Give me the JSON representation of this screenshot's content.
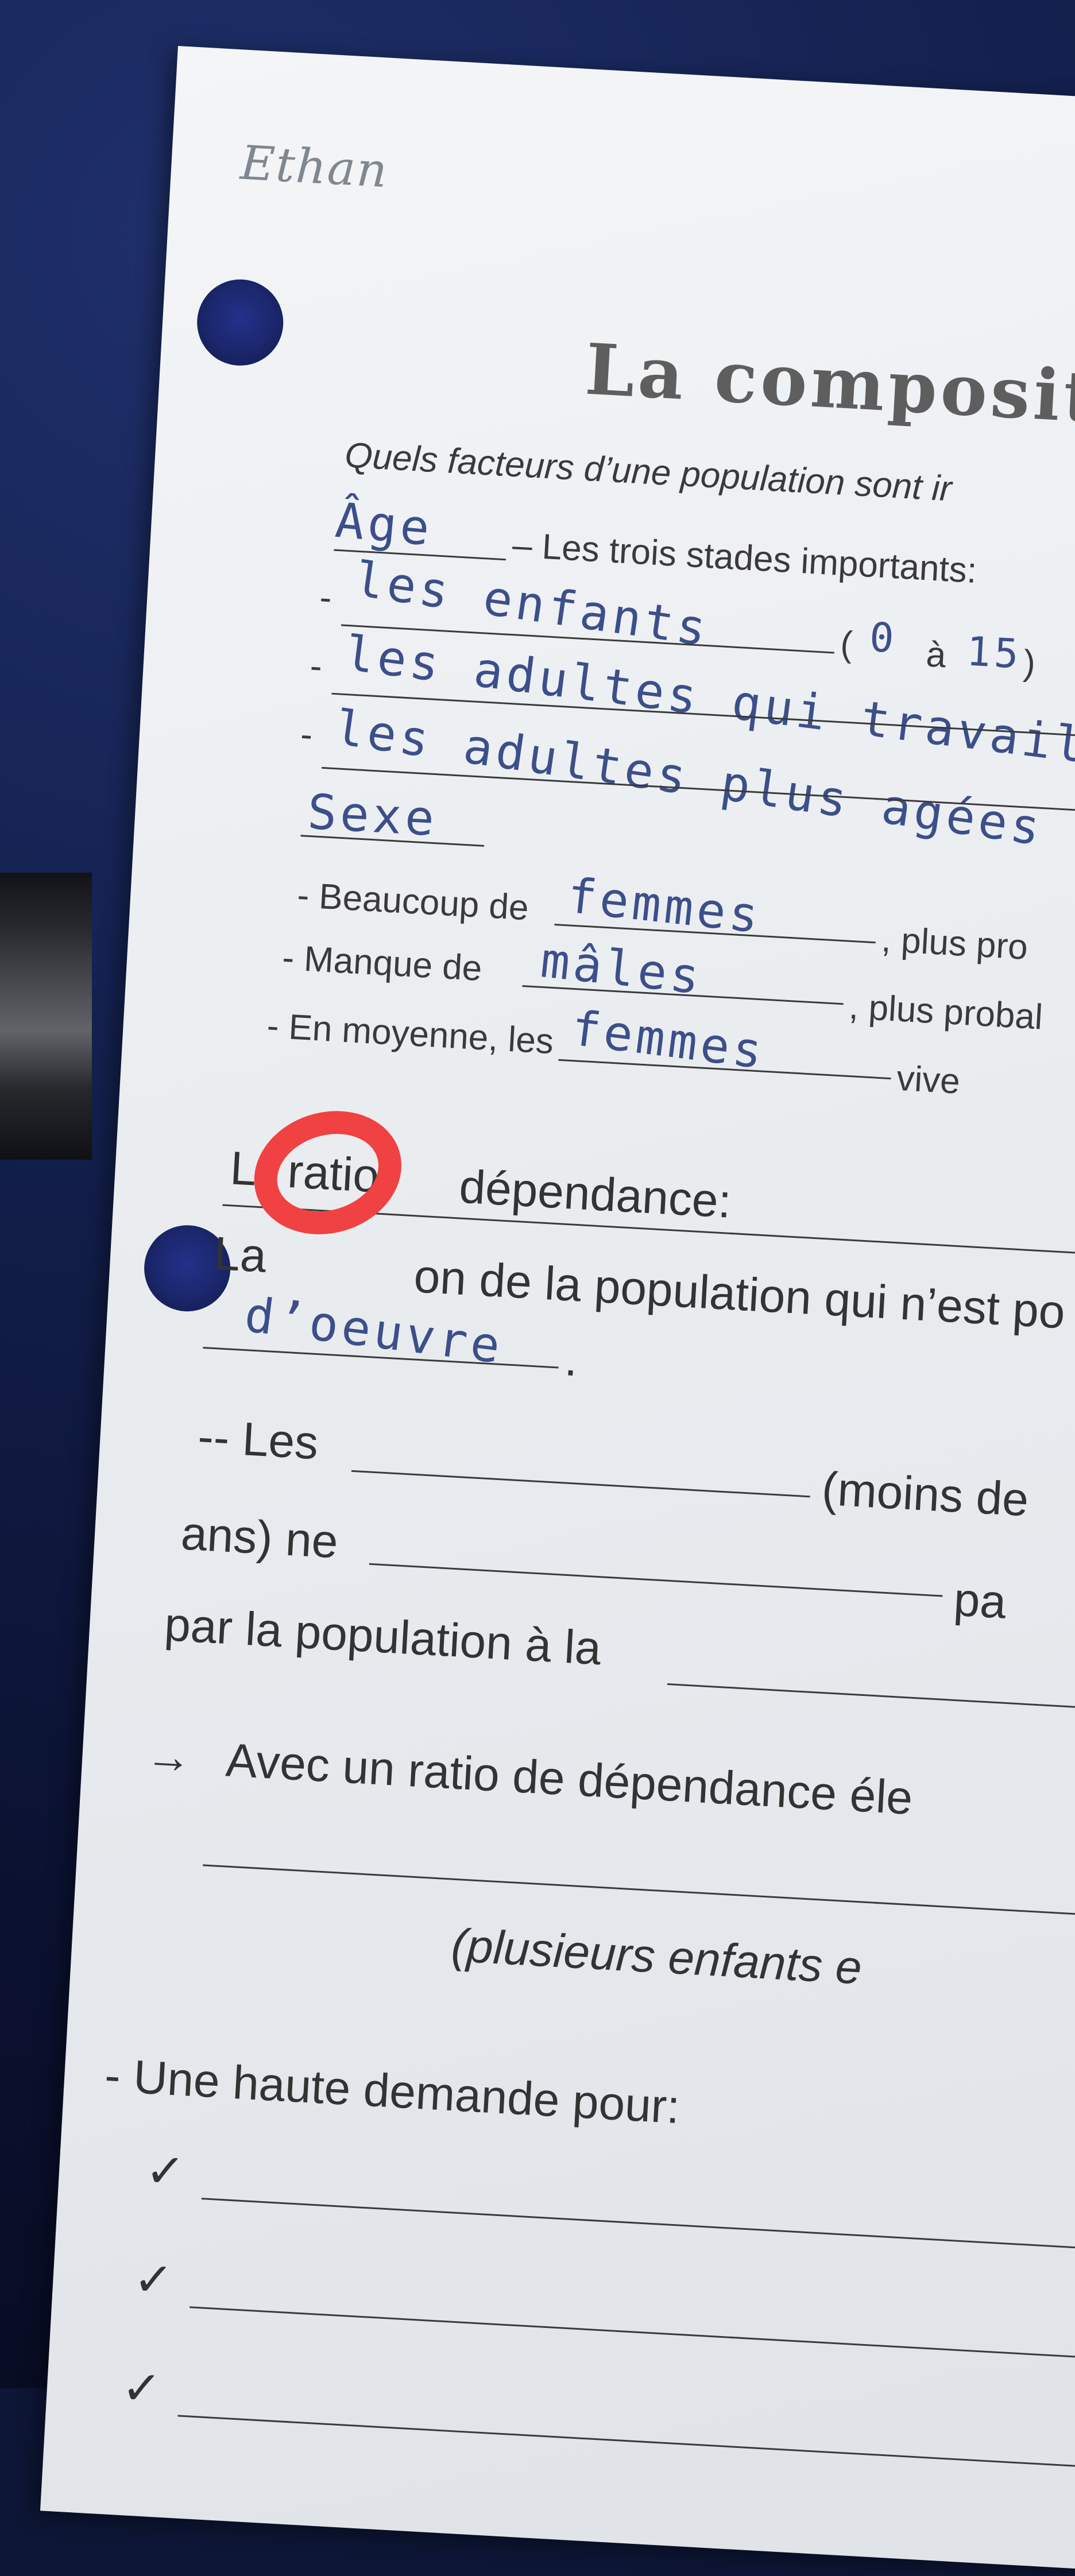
{
  "student_name": "Ethan",
  "title": "La compositio",
  "question": "Quels facteurs d’une population sont ir",
  "age": {
    "answer": "Âge",
    "label": "– Les trois stades importants:",
    "stages": [
      {
        "dash": "-",
        "answer": "les enfants"
      },
      {
        "dash": "-",
        "answer": "les adultes qui travaillen"
      },
      {
        "dash": "-",
        "answer": "les adultes plus agées"
      }
    ],
    "range_open": "(",
    "range_from": "0",
    "range_mid": "à",
    "range_to": "15",
    "range_close": ")"
  },
  "sex": {
    "answer": "Sexe",
    "lines": [
      {
        "prefix": "- Beaucoup de",
        "answer": "femmes",
        "suffix": ", plus pro"
      },
      {
        "prefix": "- Manque de",
        "answer": "mâles",
        "suffix": ", plus probal"
      },
      {
        "prefix": "- En moyenne, les",
        "answer": "femmes",
        "suffix": "vive"
      }
    ]
  },
  "ratio": {
    "heading_left": "L",
    "heading_word": "ratio",
    "heading_right": "dépendance:",
    "def_left": "La",
    "def_right": "on de la population qui n’est po",
    "def_answer": "d’oeuvre",
    "def_end": ".",
    "line1_left": "-- Les",
    "line1_right": "(moins de",
    "line2_left": "ans) ne",
    "line2_right": "pa",
    "line3_left": "par la population à la"
  },
  "arrow_text": "Avec un ratio de dépendance éle",
  "plusieurs_text": "(plusieurs enfants e",
  "demand_label": "- Une haute demande pour:",
  "checks": [
    "✓",
    "✓",
    "✓"
  ],
  "arrow_glyph": "→"
}
